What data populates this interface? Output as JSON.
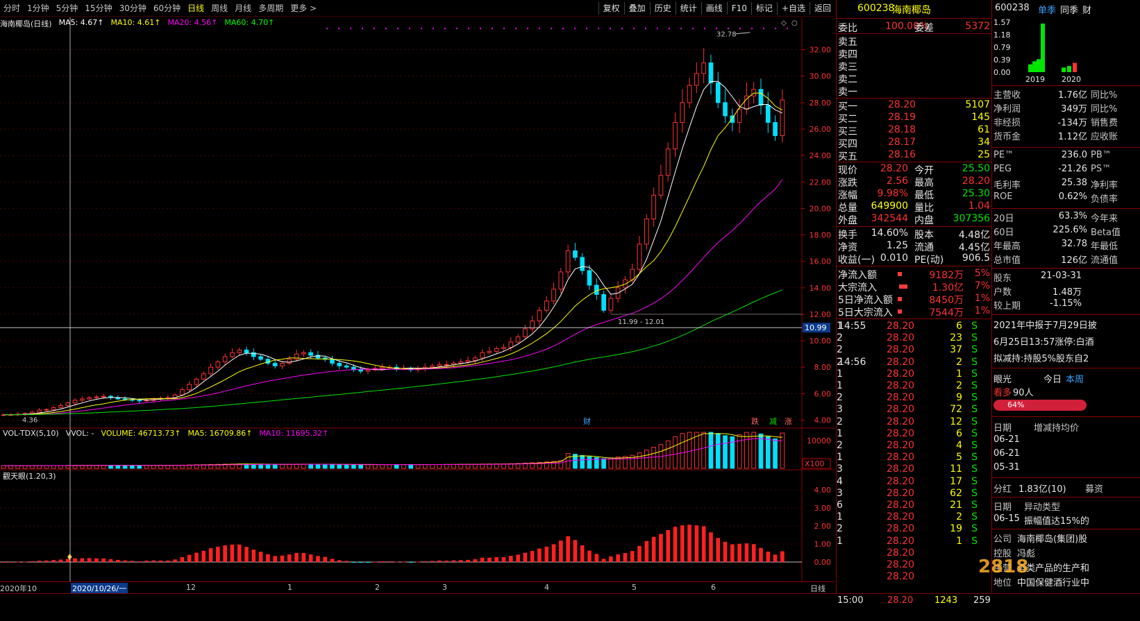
{
  "toolbar": {
    "periods": [
      "分时",
      "1分钟",
      "5分钟",
      "15分钟",
      "30分钟",
      "60分钟",
      "日线",
      "周线",
      "月线",
      "多周期",
      "更多 >"
    ],
    "active_period": "日线",
    "right_buttons": [
      "复权",
      "叠加",
      "历史",
      "统计",
      "画线",
      "F10",
      "标记",
      "+自选",
      "返回"
    ]
  },
  "main_chart": {
    "title": "海南椰岛(日线)",
    "ma_labels": [
      {
        "text": "MA5: 4.67↑",
        "color": "#ffffff"
      },
      {
        "text": "MA10: 4.61↑",
        "color": "#ffff00"
      },
      {
        "text": "MA20: 4.56↑",
        "color": "#ff00ff"
      },
      {
        "text": "MA60: 4.70↑",
        "color": "#00ff00"
      }
    ],
    "price_ticks": [
      "32.00",
      "30.00",
      "28.00",
      "26.00",
      "24.00",
      "22.00",
      "20.00",
      "18.00",
      "16.00",
      "14.00",
      "12.00",
      "10.00",
      "8.00",
      "6.00",
      "4.00"
    ],
    "high_label": "32.78",
    "low_label": "4.36",
    "range_label": "11.99 - 12.01",
    "cursor_price": "10.99",
    "markers": [
      "财",
      "跌",
      "减",
      "涨"
    ]
  },
  "chart_data": {
    "type": "candlestick",
    "ylim": [
      3.5,
      33.5
    ],
    "high": 32.78,
    "low": 4.36,
    "closes": [
      4.4,
      4.41,
      4.45,
      4.5,
      4.6,
      4.75,
      4.8,
      4.95,
      5.1,
      5.3,
      5.5,
      5.6,
      5.7,
      5.75,
      5.8,
      5.7,
      5.6,
      5.55,
      5.5,
      5.45,
      5.5,
      5.6,
      5.65,
      5.7,
      5.9,
      6.3,
      6.7,
      7.1,
      7.5,
      8.0,
      8.4,
      8.8,
      9.1,
      9.3,
      9.1,
      8.8,
      8.6,
      8.3,
      8.1,
      8.3,
      8.6,
      9.0,
      9.1,
      8.9,
      8.7,
      8.6,
      8.3,
      8.1,
      8.0,
      7.8,
      7.7,
      7.8,
      7.9,
      8.0,
      8.0,
      7.9,
      7.9,
      7.8,
      7.9,
      8.0,
      8.1,
      8.2,
      8.2,
      8.3,
      8.4,
      8.5,
      8.7,
      9.1,
      9.2,
      9.4,
      9.5,
      9.9,
      10.3,
      10.9,
      11.5,
      12.3,
      13.0,
      13.9,
      15.2,
      16.8,
      16.3,
      15.3,
      14.2,
      13.5,
      12.3,
      13.2,
      14.0,
      14.6,
      15.4,
      17.3,
      19.2,
      21.0,
      22.5,
      24.5,
      26.5,
      28.0,
      29.3,
      30.2,
      31.0,
      29.5,
      28.0,
      27.0,
      26.5,
      27.5,
      28.5,
      29.0,
      27.8,
      26.5,
      25.5,
      28.2
    ],
    "ma5": [
      4.4,
      4.41,
      4.42,
      4.44,
      4.47,
      4.54,
      4.62,
      4.72,
      4.84,
      4.99,
      5.15,
      5.3,
      5.45,
      5.57,
      5.67,
      5.71,
      5.71,
      5.68,
      5.63,
      5.56,
      5.52,
      5.54,
      5.58,
      5.62,
      5.69,
      5.87,
      6.13,
      6.48,
      6.91,
      7.3,
      7.7,
      8.16,
      8.56,
      8.9,
      9.06,
      9.04,
      8.98,
      8.82,
      8.58,
      8.41,
      8.38,
      8.48,
      8.62,
      8.78,
      8.86,
      8.84,
      8.64,
      8.46,
      8.33,
      8.14,
      7.96,
      7.86,
      7.82,
      7.8,
      7.85,
      7.88,
      7.91,
      7.93,
      7.92,
      7.92,
      7.95,
      8.02,
      8.09,
      8.18,
      8.27,
      8.35,
      8.46,
      8.63,
      8.82,
      9.01,
      9.2,
      9.46,
      9.74,
      10.11,
      10.52,
      11.06,
      11.75,
      12.54,
      13.44,
      14.62,
      15.42,
      15.6,
      15.55,
      15.01,
      14.19,
      13.51,
      13.6,
      13.92,
      14.26,
      15.06,
      16.16,
      17.6,
      19.05,
      20.89,
      22.75,
      24.52,
      26.14,
      27.7,
      29.0,
      29.6,
      29.6,
      29.14,
      28.44,
      27.7,
      27.5,
      27.7,
      27.86,
      27.86,
      27.46,
      27.2
    ],
    "ma10": [
      4.4,
      4.4,
      4.41,
      4.42,
      4.44,
      4.48,
      4.52,
      4.58,
      4.65,
      4.74,
      4.83,
      4.94,
      5.05,
      5.15,
      5.23,
      5.34,
      5.43,
      5.52,
      5.56,
      5.59,
      5.61,
      5.63,
      5.63,
      5.62,
      5.61,
      5.7,
      5.84,
      6.03,
      6.26,
      6.51,
      6.78,
      7.06,
      7.36,
      7.66,
      7.88,
      8.05,
      8.24,
      8.4,
      8.54,
      8.6,
      8.7,
      8.7,
      8.66,
      8.64,
      8.63,
      8.62,
      8.6,
      8.57,
      8.53,
      8.47,
      8.39,
      8.27,
      8.15,
      8.04,
      7.97,
      7.93,
      7.89,
      7.85,
      7.87,
      7.89,
      7.91,
      7.95,
      7.99,
      8.05,
      8.11,
      8.17,
      8.26,
      8.39,
      8.52,
      8.66,
      8.81,
      9.0,
      9.24,
      9.52,
      9.82,
      10.17,
      10.54,
      10.96,
      11.46,
      12.04,
      12.62,
      13.07,
      13.46,
      13.78,
      13.93,
      14.0,
      14.1,
      14.28,
      14.6,
      15.08,
      15.6,
      16.05,
      16.74,
      17.6,
      18.61,
      19.76,
      20.92,
      22.1,
      23.19,
      24.45,
      25.5,
      26.1,
      26.82,
      27.62,
      28.28,
      28.72,
      28.71,
      28.32,
      27.73,
      27.43
    ],
    "ma20": [
      4.4,
      4.4,
      4.4,
      4.41,
      4.42,
      4.44,
      4.46,
      4.5,
      4.54,
      4.59,
      4.64,
      4.7,
      4.77,
      4.84,
      4.91,
      4.99,
      5.06,
      5.13,
      5.2,
      5.26,
      5.32,
      5.38,
      5.44,
      5.49,
      5.54,
      5.6,
      5.67,
      5.75,
      5.84,
      5.94,
      6.06,
      6.19,
      6.32,
      6.46,
      6.59,
      6.71,
      6.83,
      6.94,
      7.04,
      7.13,
      7.22,
      7.32,
      7.4,
      7.48,
      7.55,
      7.62,
      7.68,
      7.74,
      7.78,
      7.82,
      7.85,
      7.86,
      7.86,
      7.86,
      7.85,
      7.84,
      7.82,
      7.82,
      7.83,
      7.86,
      7.88,
      7.9,
      7.93,
      7.96,
      8.01,
      8.07,
      8.13,
      8.21,
      8.29,
      8.37,
      8.46,
      8.56,
      8.68,
      8.83,
      8.99,
      9.17,
      9.37,
      9.6,
      9.87,
      10.18,
      10.49,
      10.77,
      11.02,
      11.22,
      11.39,
      11.57,
      11.73,
      11.9,
      12.06,
      12.3,
      12.55,
      12.84,
      13.18,
      13.57,
      14.04,
      14.55,
      15.11,
      15.7,
      16.31,
      16.88,
      17.42,
      17.88,
      18.33,
      18.84,
      19.39,
      19.99,
      20.52,
      20.99,
      21.46,
      22.2
    ],
    "ma60": [
      4.4,
      4.4,
      4.41,
      4.41,
      4.42,
      4.43,
      4.44,
      4.45,
      4.47,
      4.48,
      4.5,
      4.52,
      4.54,
      4.56,
      4.58,
      4.61,
      4.63,
      4.66,
      4.68,
      4.71,
      4.73,
      4.76,
      4.79,
      4.82,
      4.85,
      4.88,
      4.91,
      4.95,
      4.99,
      5.03,
      5.08,
      5.13,
      5.18,
      5.23,
      5.28,
      5.33,
      5.38,
      5.43,
      5.48,
      5.53,
      5.58,
      5.63,
      5.68,
      5.73,
      5.79,
      5.84,
      5.89,
      5.94,
      5.99,
      6.05,
      6.1,
      6.16,
      6.21,
      6.27,
      6.32,
      6.38,
      6.43,
      6.49,
      6.55,
      6.61,
      6.67,
      6.73,
      6.79,
      6.86,
      6.92,
      6.99,
      7.06,
      7.13,
      7.2,
      7.28,
      7.36,
      7.44,
      7.53,
      7.62,
      7.71,
      7.81,
      7.91,
      8.02,
      8.14,
      8.27,
      8.39,
      8.5,
      8.6,
      8.69,
      8.77,
      8.86,
      8.96,
      9.06,
      9.17,
      9.3,
      9.44,
      9.6,
      9.77,
      9.96,
      10.17,
      10.4,
      10.64,
      10.9,
      11.17,
      11.44,
      11.69,
      11.93,
      12.17,
      12.42,
      12.68,
      12.94,
      13.18,
      13.41,
      13.63,
      13.85
    ]
  },
  "volume_panel": {
    "title": "VOL-TDX(5,10)",
    "vol_label": "VVOL: -",
    "volume_label": "VOLUME: 46713.73↑",
    "ma5_label": "MA5: 16709.86↑",
    "ma10_label": "MA10: 11695.32↑",
    "tick": "10000",
    "unit": "X100"
  },
  "indicator_panel": {
    "title": "觀天眼(1.20,3)",
    "ticks": [
      "4.00",
      "3.00",
      "2.00",
      "1.00",
      "0.00"
    ]
  },
  "date_axis": [
    "2020年10",
    "2020/10/26/一",
    "12",
    "1",
    "2",
    "3",
    "4",
    "5",
    "6"
  ],
  "period_label": "日线",
  "quote": {
    "code": "600238",
    "name": "海南椰岛",
    "webi_label": "委比",
    "webi_value": "100.00%",
    "weicha_label": "委差",
    "weicha_value": "5372",
    "asks": [
      "卖五",
      "卖四",
      "卖三",
      "卖二",
      "卖一"
    ],
    "bids": [
      {
        "label": "买一",
        "price": "28.20",
        "vol": "5107"
      },
      {
        "label": "买二",
        "price": "28.19",
        "vol": "145"
      },
      {
        "label": "买三",
        "price": "28.18",
        "vol": "61"
      },
      {
        "label": "买四",
        "price": "28.17",
        "vol": "34"
      },
      {
        "label": "买五",
        "price": "28.16",
        "vol": "25"
      }
    ],
    "stats": [
      {
        "l1": "现价",
        "v1": "28.20",
        "c1": "red",
        "l2": "今开",
        "v2": "25.50",
        "c2": "green"
      },
      {
        "l1": "涨跌",
        "v1": "2.56",
        "c1": "red",
        "l2": "最高",
        "v2": "28.20",
        "c2": "red"
      },
      {
        "l1": "涨幅",
        "v1": "9.98%",
        "c1": "red",
        "l2": "最低",
        "v2": "25.30",
        "c2": "green"
      },
      {
        "l1": "总量",
        "v1": "649900",
        "c1": "yellow",
        "l2": "量比",
        "v2": "1.04",
        "c2": "red"
      },
      {
        "l1": "外盘",
        "v1": "342544",
        "c1": "red",
        "l2": "内盘",
        "v2": "307356",
        "c2": "green"
      }
    ],
    "stats2": [
      {
        "l1": "换手",
        "v1": "14.60%",
        "l2": "股本",
        "v2": "4.48亿"
      },
      {
        "l1": "净资",
        "v1": "1.25",
        "l2": "流通",
        "v2": "4.45亿"
      },
      {
        "l1": "收益(一)",
        "v1": "0.010",
        "l2": "PE(动)",
        "v2": "906.5"
      }
    ],
    "flows": [
      {
        "label": "净流入额",
        "value": "9182万",
        "pct": "5%"
      },
      {
        "label": "大宗流入",
        "value": "1.30亿",
        "pct": "7%"
      },
      {
        "label": "5日净流入额",
        "value": "8450万",
        "pct": "1%"
      },
      {
        "label": "5日大宗流入",
        "value": "7544万",
        "pct": "1%"
      }
    ],
    "ticks": [
      {
        "time": "14:55",
        "price": "28.20",
        "vol": "6",
        "side": "S",
        "n": "1"
      },
      {
        "time": "",
        "price": "28.20",
        "vol": "23",
        "side": "S",
        "n": "2"
      },
      {
        "time": "",
        "price": "28.20",
        "vol": "37",
        "side": "S",
        "n": "2"
      },
      {
        "time": "14:56",
        "price": "28.20",
        "vol": "2",
        "side": "S",
        "n": "2"
      },
      {
        "time": "",
        "price": "28.20",
        "vol": "1",
        "side": "S",
        "n": "1"
      },
      {
        "time": "",
        "price": "28.20",
        "vol": "2",
        "side": "S",
        "n": "1"
      },
      {
        "time": "",
        "price": "28.20",
        "vol": "9",
        "side": "S",
        "n": "2"
      },
      {
        "time": "",
        "price": "28.20",
        "vol": "72",
        "side": "S",
        "n": "3"
      },
      {
        "time": "",
        "price": "28.20",
        "vol": "12",
        "side": "S",
        "n": "2"
      },
      {
        "time": "",
        "price": "28.20",
        "vol": "6",
        "side": "S",
        "n": "1"
      },
      {
        "time": "",
        "price": "28.20",
        "vol": "4",
        "side": "S",
        "n": "2"
      },
      {
        "time": "",
        "price": "28.20",
        "vol": "5",
        "side": "S",
        "n": "1"
      },
      {
        "time": "",
        "price": "28.20",
        "vol": "11",
        "side": "S",
        "n": "3"
      },
      {
        "time": "",
        "price": "28.20",
        "vol": "17",
        "side": "S",
        "n": "4"
      },
      {
        "time": "",
        "price": "28.20",
        "vol": "62",
        "side": "S",
        "n": "3"
      },
      {
        "time": "",
        "price": "28.20",
        "vol": "21",
        "side": "S",
        "n": "6"
      },
      {
        "time": "",
        "price": "28.20",
        "vol": "2",
        "side": "S",
        "n": "1"
      },
      {
        "time": "",
        "price": "28.20",
        "vol": "19",
        "side": "S",
        "n": "2"
      },
      {
        "time": "",
        "price": "28.20",
        "vol": "1",
        "side": "S",
        "n": "1"
      },
      {
        "time": "",
        "price": "28.20",
        "vol": "",
        "side": "",
        "n": ""
      },
      {
        "time": "",
        "price": "28.20",
        "vol": "",
        "side": "",
        "n": ""
      },
      {
        "time": "",
        "price": "28.20",
        "vol": "",
        "side": "",
        "n": ""
      }
    ],
    "last_tick": {
      "time": "15:00",
      "price": "28.20",
      "vol": "1243",
      "n": "259"
    }
  },
  "fundamentals": {
    "code": "600238",
    "tabs": [
      "单季",
      "同季",
      "财"
    ],
    "years": [
      "2019",
      "2020"
    ],
    "yticks": [
      "1.57",
      "1.18",
      "0.79",
      "0.39",
      "0.00"
    ],
    "bar_values": [
      0.25,
      0.35,
      0.42,
      1.57,
      0.15,
      0.2,
      0.3
    ],
    "rows1": [
      {
        "label": "主营收",
        "value": "1.76亿",
        "right": "同比%"
      },
      {
        "label": "净利润",
        "value": "349万",
        "right": "同比%"
      },
      {
        "label": "非经损",
        "value": "-134万",
        "right": "销售费"
      },
      {
        "label": "货币金",
        "value": "1.12亿",
        "right": "应收账"
      }
    ],
    "rows2": [
      {
        "label": "PE™",
        "value": "236.0",
        "right": "PB™"
      },
      {
        "label": "PEG",
        "value": "-21.26",
        "right": "PS™"
      },
      {
        "label": "毛利率",
        "value": "25.38",
        "right": "净利率"
      },
      {
        "label": "ROE",
        "value": "0.62%",
        "right": "负债率"
      }
    ],
    "rows3": [
      {
        "label": "20日",
        "value": "63.3%",
        "right": "今年来"
      },
      {
        "label": "60日",
        "value": "225.6%",
        "right": "Beta值"
      },
      {
        "label": "年最高",
        "value": "32.78",
        "right": "年最低"
      },
      {
        "label": "总市值",
        "value": "126亿",
        "right": "流通值"
      }
    ],
    "holders": [
      {
        "label": "股东",
        "value": "21-03-31"
      },
      {
        "label": "户数",
        "value": "1.48万"
      },
      {
        "label": "较上期",
        "value": "-1.15%"
      }
    ],
    "news": [
      "2021年中报于7月29日披",
      "6月25日13:57涨停:白酒",
      "拟减持:持股5%股东自2"
    ],
    "eye": {
      "label": "眼光",
      "today": "今日",
      "week": "本周",
      "bull": "看多",
      "count": "90人",
      "pct": "64%"
    },
    "holding": {
      "h1": "日期",
      "h2": "增减持均价",
      "dates": [
        "06-21",
        "06-21",
        "05-31"
      ]
    },
    "dividend": {
      "label": "分红",
      "value": "1.83亿(10)",
      "right": "募资"
    },
    "anomaly": {
      "h1": "日期",
      "h2": "异动类型",
      "date": "06-15",
      "type": "振幅值达15%的"
    },
    "company": [
      {
        "label": "公司",
        "value": "海南椰岛(集团)股"
      },
      {
        "label": "控股",
        "value": "冯彪"
      },
      {
        "label": "主营",
        "value": "酒类产品的生产和"
      },
      {
        "label": "地位",
        "value": "中国保健酒行业中"
      }
    ],
    "watermark": "2818"
  }
}
